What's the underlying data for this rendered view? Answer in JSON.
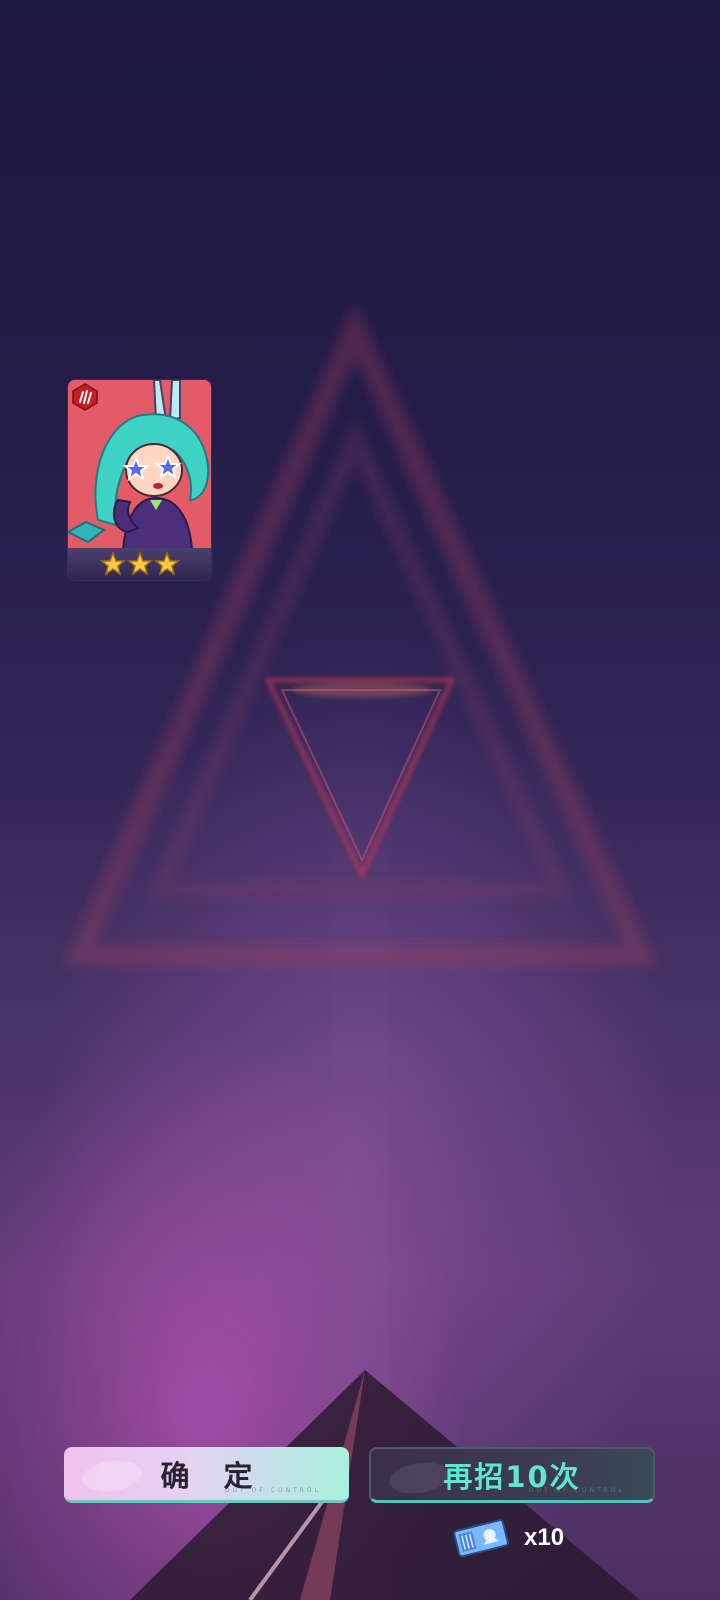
{
  "hero_card": {
    "stars": 3,
    "faction_icon": "claw-mark-icon",
    "portrait": "bunny-girl-hero-portrait",
    "colors": {
      "portrait_bg": "#e0515f",
      "hair": "#3fd3c6",
      "star": "#f6c945"
    }
  },
  "buttons": {
    "confirm_label": "确 定",
    "confirm_sub": "OUT OF CONTROL",
    "retry_label": "再招10次",
    "retry_sub": "OUT OF CONTROL"
  },
  "cost": {
    "icon": "recruit-ticket-icon",
    "text": "x10"
  },
  "colors": {
    "accent_teal": "#5de6d0",
    "confirm_pink": "#f1c2ef",
    "triangle_red": "#c2344f"
  }
}
